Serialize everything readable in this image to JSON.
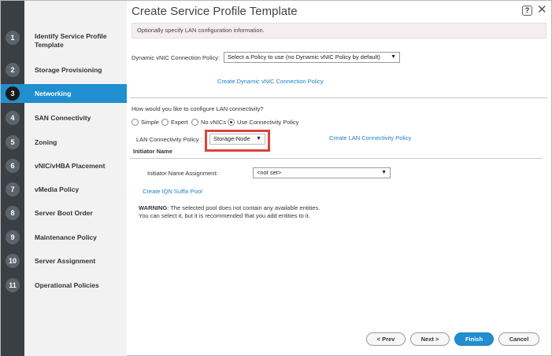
{
  "window": {
    "title": "Create Service Profile Template",
    "help_label": "?",
    "close_label": "✕"
  },
  "steps": [
    {
      "num": "1",
      "label": "Identify Service Profile Template"
    },
    {
      "num": "2",
      "label": "Storage Provisioning"
    },
    {
      "num": "3",
      "label": "Networking"
    },
    {
      "num": "4",
      "label": "SAN Connectivity"
    },
    {
      "num": "5",
      "label": "Zoning"
    },
    {
      "num": "6",
      "label": "vNIC/vHBA Placement"
    },
    {
      "num": "7",
      "label": "vMedia Policy"
    },
    {
      "num": "8",
      "label": "Server Boot Order"
    },
    {
      "num": "9",
      "label": "Maintenance Policy"
    },
    {
      "num": "10",
      "label": "Server Assignment"
    },
    {
      "num": "11",
      "label": "Operational Policies"
    }
  ],
  "active_step": "3",
  "main": {
    "info_text": "Optionally specify LAN configuration information.",
    "dynamic_vnic_label": "Dynamic vNIC Connection Policy:",
    "dynamic_vnic_value": "Select a Policy to use (no Dynamic vNIC Policy by default)",
    "create_dynamic_link": "Create Dynamic vNIC Connection Policy",
    "lan_question": "How would you like to configure LAN connectivity?",
    "radio_options": [
      "Simple",
      "Expert",
      "No vNICs",
      "Use Connectivity Policy"
    ],
    "radio_selected": "Use Connectivity Policy",
    "lan_policy_label": "LAN Connectivity Policy :",
    "lan_policy_value": "Storage-Node",
    "create_lan_link": "Create LAN Connectivity Policy",
    "initiator_heading": "Initiator Name",
    "initiator_assign_label": "Initiator Name Assignment:",
    "initiator_assign_value": "<not set>",
    "create_iqn_link": "Create IQN Suffix Pool",
    "warning_bold": "WARNING",
    "warning_line1": ": The selected pool does not contain any available entities.",
    "warning_line2": "You can select it, but it is recommended that you add entities to it."
  },
  "footer": {
    "prev": "< Prev",
    "next": "Next >",
    "finish": "Finish",
    "cancel": "Cancel"
  },
  "colors": {
    "accent": "#1f8fd0",
    "highlight": "#d9443a",
    "sidebar": "#3a3f44"
  }
}
